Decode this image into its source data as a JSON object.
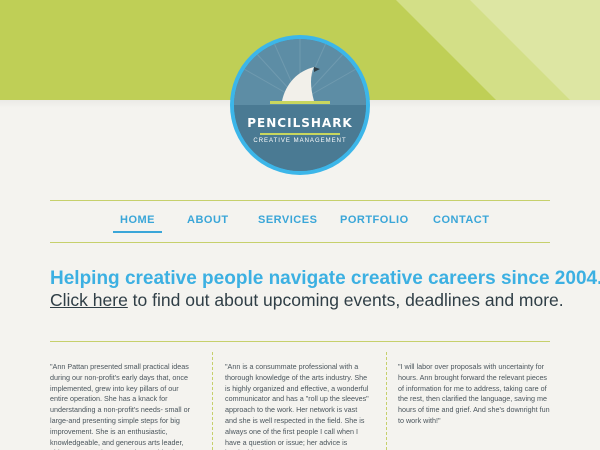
{
  "brand": {
    "name": "PENCILSHARK",
    "tagline": "CREATIVE MANAGEMENT"
  },
  "colors": {
    "header_green": "#bfcf56",
    "accent_blue": "#3cb0e2",
    "logo_blue": "#3cb6e9",
    "logo_fill": "#4f7f97",
    "rule_green": "#c6d06c",
    "background": "#f4f3ef"
  },
  "nav": {
    "active": "HOME",
    "items": [
      {
        "label": "HOME"
      },
      {
        "label": "ABOUT"
      },
      {
        "label": "SERVICES"
      },
      {
        "label": "PORTFOLIO"
      },
      {
        "label": "CONTACT"
      }
    ]
  },
  "hero": {
    "headline": "Helping creative people navigate creative careers since 2004.",
    "link_text": "Click here",
    "link_rest": " to find out about upcoming events, deadlines and more."
  },
  "testimonials": [
    {
      "text": "\"Ann Pattan presented small practical ideas during our non-profit's early days that, once implemented, grew into key pillars of our entire operation. She has a knack for understanding a non-profit's needs- small or large-and presenting simple steps for big improvement. She is an enthusiastic, knowledgeable, and generous arts leader, able to communicate to artists and business leaders alike, and brings a"
    },
    {
      "text": "\"Ann is a consummate professional with a thorough knowledge of the arts industry. She is highly organized and effective, a wonderful communicator and has a \"roll up the sleeves\" approach to the work. Her network is vast and she is well respected in the field. She is always one of the first people I call when I have a question or issue; her advice is invaluable.\""
    },
    {
      "text": "\"I will labor over proposals with uncertainty for hours. Ann brought forward the relevant pieces of information for me to address, taking care of the rest, then clarified the language, saving me hours of time and grief. And she's downright fun to work with!\""
    }
  ]
}
